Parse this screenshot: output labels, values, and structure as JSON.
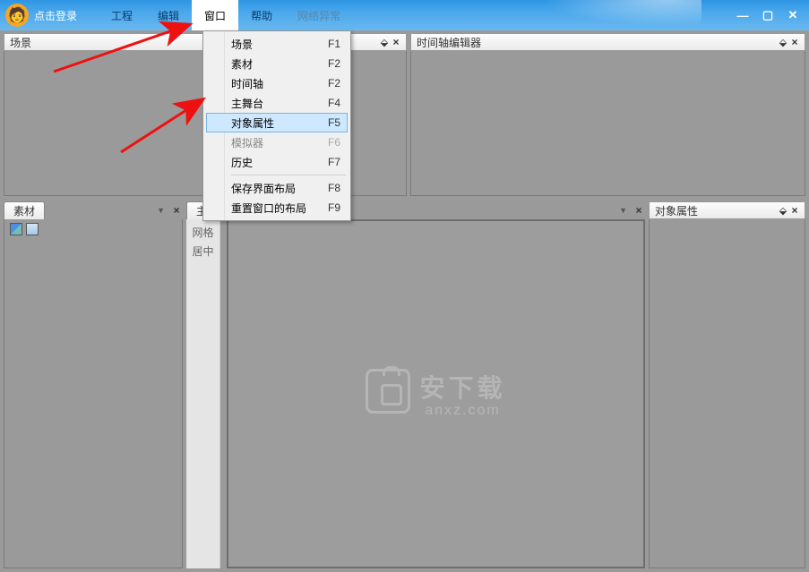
{
  "title": "点击登录",
  "menubar": {
    "items": [
      {
        "label": "工程"
      },
      {
        "label": "编辑"
      },
      {
        "label": "窗口",
        "active": true
      },
      {
        "label": "帮助"
      },
      {
        "label": "网络异常",
        "greyed": true
      }
    ]
  },
  "dropdown": {
    "items": [
      {
        "label": "场景",
        "shortcut": "F1"
      },
      {
        "label": "素材",
        "shortcut": "F2"
      },
      {
        "label": "时间轴",
        "shortcut": "F2"
      },
      {
        "label": "主舞台",
        "shortcut": "F4"
      },
      {
        "label": "对象属性",
        "shortcut": "F5",
        "highlighted": true
      },
      {
        "label": "模拟器",
        "shortcut": "F6",
        "disabled": true
      },
      {
        "label": "历史",
        "shortcut": "F7"
      }
    ],
    "items2": [
      {
        "label": "保存界面布局",
        "shortcut": "F8"
      },
      {
        "label": "重置窗口的布局",
        "shortcut": "F9"
      }
    ]
  },
  "panels": {
    "scene": {
      "title": "场景"
    },
    "timeline": {
      "title": "时间轴编辑器"
    },
    "material": {
      "title": "素材"
    },
    "stage": {
      "title": "主舞台",
      "sidebar": [
        "网格",
        "居中"
      ]
    },
    "props": {
      "title": "对象属性"
    }
  },
  "watermark": {
    "main": "安下载",
    "sub": "anxz.com"
  },
  "win_controls": {
    "min": "—",
    "max": "▢",
    "close": "✕"
  }
}
